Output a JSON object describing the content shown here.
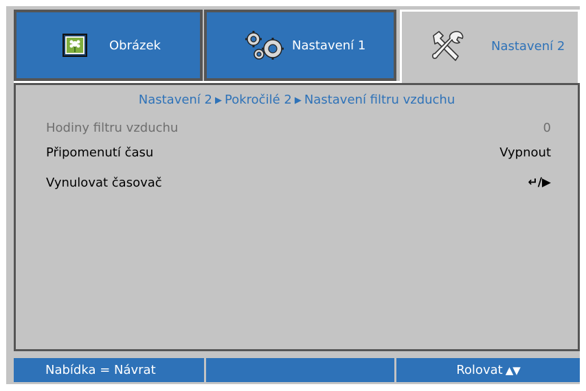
{
  "tabs": [
    {
      "label": "Obrázek",
      "icon": "picture-icon"
    },
    {
      "label": "Nastavení 1",
      "icon": "gears-icon"
    },
    {
      "label": "Nastavení 2",
      "icon": "tools-icon"
    }
  ],
  "breadcrumb": {
    "part1": "Nastavení 2",
    "part2": "Pokročilé 2",
    "part3": "Nastavení filtru vzduchu",
    "separator": "▶"
  },
  "rows": [
    {
      "label": "Hodiny filtru vzduchu",
      "value": "0"
    },
    {
      "label": "Připomenutí času",
      "value": "Vypnout"
    },
    {
      "label": "Vynulovat časovač",
      "value": "↵/▶"
    }
  ],
  "bottom_bar": {
    "left": "Nabídka = Návrat",
    "middle": "",
    "right": "Rolovat",
    "right_arrows": "▲▼"
  },
  "colors": {
    "accent": "#2e72b8",
    "panel": "#c4c4c4",
    "disabled_text": "#6e6e6e"
  }
}
